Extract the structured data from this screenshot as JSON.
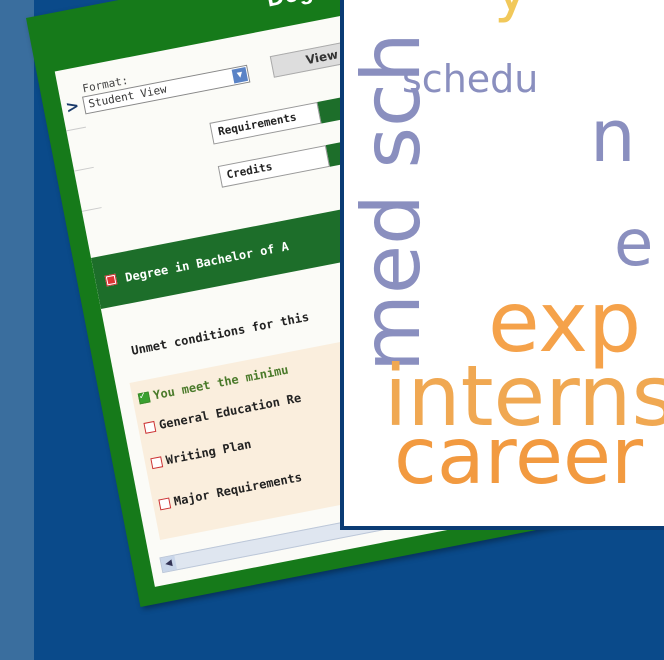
{
  "audit": {
    "title": "Degre",
    "format_label": "Format:",
    "format_value": "Student View",
    "view_button": "View",
    "requirements_label": "Requirements",
    "credits_label": "Credits",
    "degree_heading": "Degree in Bachelor of A",
    "unmet_text": "Unmet conditions for this",
    "requirements": [
      {
        "label": "You meet the minimu",
        "met": true
      },
      {
        "label": "General Education Re",
        "met": false
      },
      {
        "label": "Writing Plan",
        "met": false
      },
      {
        "label": "Major Requirements",
        "met": false
      }
    ]
  },
  "word_cloud": {
    "words": [
      "med sch",
      "schedu",
      "n",
      "e",
      "exp",
      "interns",
      "career",
      "y"
    ]
  },
  "colors": {
    "background": "#0a4a8a",
    "card_green": "#167a1a",
    "cloud_purple": "#8a8fbf",
    "cloud_orange": "#f5a24a"
  }
}
